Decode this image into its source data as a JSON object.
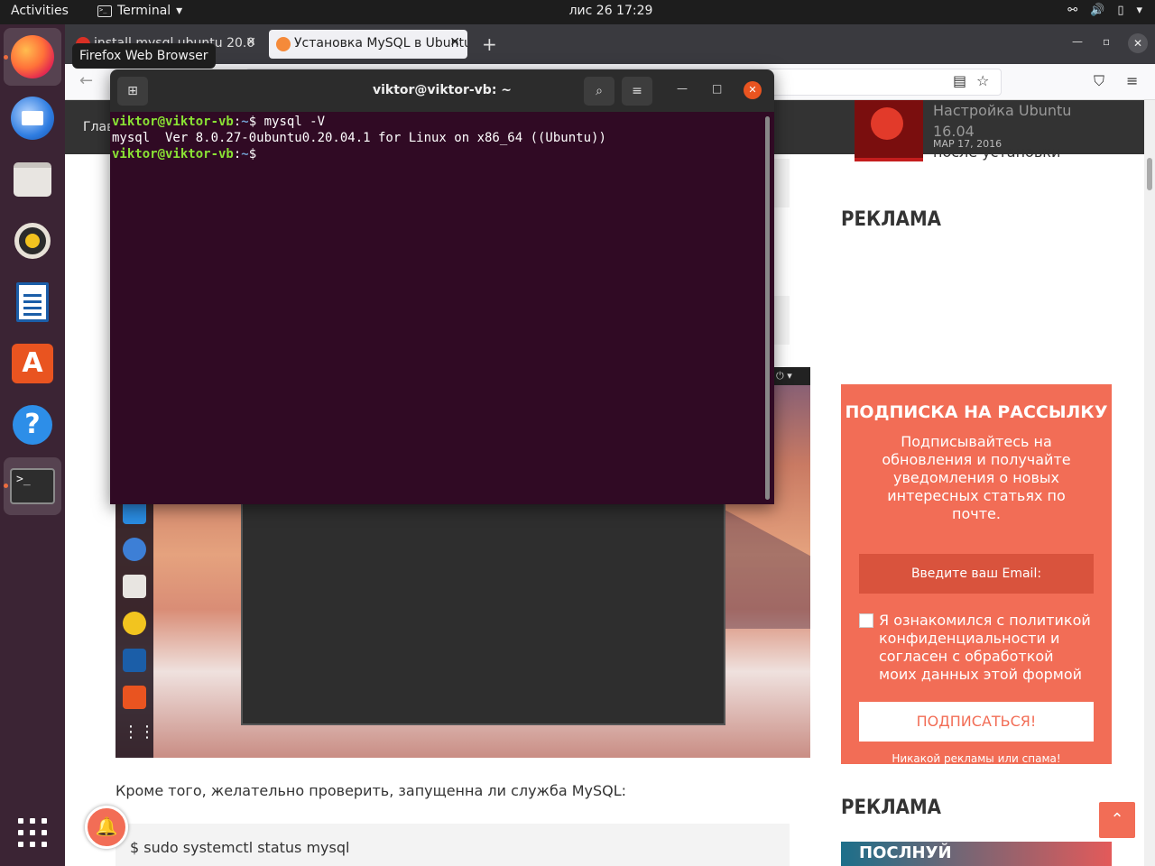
{
  "topbar": {
    "activities": "Activities",
    "app_name": "Terminal",
    "clock": "лис 26  17:29"
  },
  "dock": {
    "tooltip": "Firefox Web Browser",
    "apps": [
      "firefox",
      "thunderbird",
      "files",
      "rhythmbox",
      "libreoffice-writer",
      "ubuntu-software",
      "help",
      "terminal",
      "show-applications"
    ]
  },
  "browser": {
    "tabs": [
      {
        "title": "install mysql ubuntu 20.0"
      },
      {
        "title": "Установка MySQL в Ubuntu"
      }
    ],
    "page": {
      "menu_first": "Глав",
      "related": {
        "title_line1": "Настройка Ubuntu 16.04",
        "title_line2": "после установки",
        "date": "МАР 17, 2016"
      },
      "ad_heading_1": "РЕКЛАМА",
      "ad_heading_2": "РЕКЛАМА",
      "paragraph": "Кроме того, желательно проверить, запущенна ли служба MySQL:",
      "command": "$  sudo systemctl status mysql",
      "subscribe": {
        "title": "ПОДПИСКА НА РАССЫЛКУ",
        "description": "Подписывайтесь на обновления и получайте уведомления о новых интересных статьях по почте.",
        "email_placeholder": "Введите ваш Email:",
        "consent": "Я ознакомился с политикой конфиденциальности и согласен с обработкой моих данных этой формой",
        "button": "ПОДПИСАТЬСЯ!",
        "note": "Никакой рекламы или спама!"
      },
      "ad_image_text": "ПОСЛНУЙ"
    }
  },
  "terminal": {
    "title": "viktor@viktor-vb: ~",
    "lines": [
      {
        "user": "viktor@viktor-vb",
        "path": "~",
        "cmd": " mysql -V"
      },
      {
        "output": "mysql  Ver 8.0.27-0ubuntu0.20.04.1 for Linux on x86_64 ((Ubuntu))"
      },
      {
        "user": "viktor@viktor-vb",
        "path": "~",
        "cmd": " "
      }
    ]
  },
  "colors": {
    "terminal_bg": "#300a24",
    "accent": "#f26d56",
    "ubuntu_orange": "#e95420",
    "prompt_user": "#8ae234",
    "prompt_path": "#729fcf"
  }
}
